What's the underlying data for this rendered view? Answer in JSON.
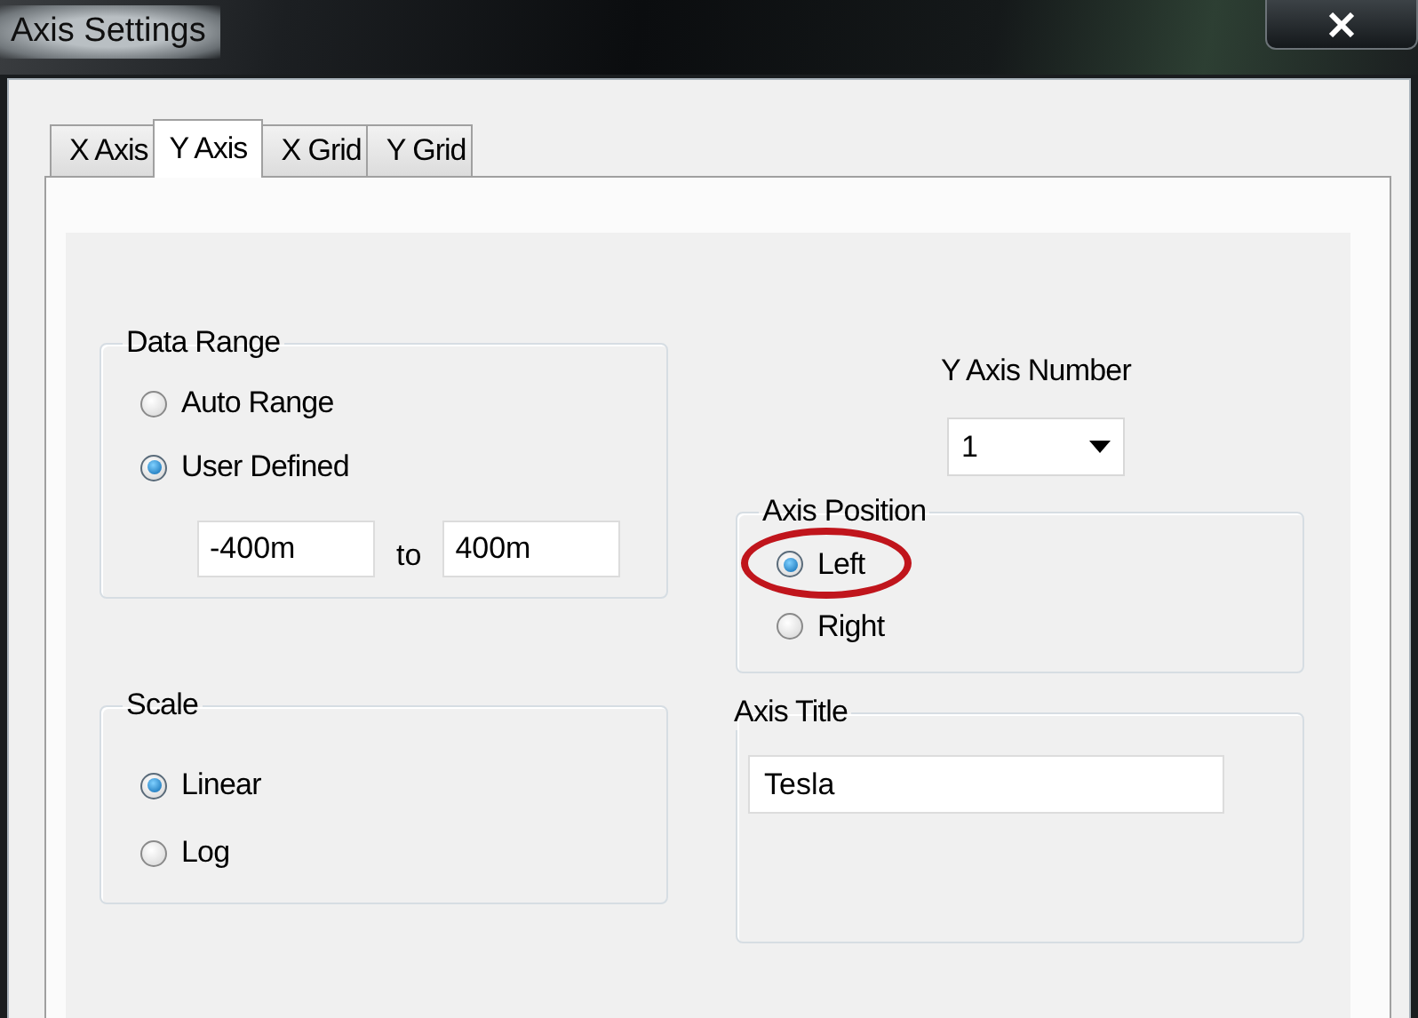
{
  "window": {
    "title": "Axis Settings"
  },
  "tabs": [
    {
      "label": "X Axis",
      "selected": false
    },
    {
      "label": "Y Axis",
      "selected": true
    },
    {
      "label": "X Grid",
      "selected": false
    },
    {
      "label": "Y Grid",
      "selected": false
    }
  ],
  "data_range": {
    "title": "Data Range",
    "options": [
      {
        "label": "Auto Range",
        "selected": false
      },
      {
        "label": "User Defined",
        "selected": true
      }
    ],
    "from": "-400m",
    "to_label": "to",
    "to": "400m"
  },
  "scale": {
    "title": "Scale",
    "options": [
      {
        "label": "Linear",
        "selected": true
      },
      {
        "label": "Log",
        "selected": false
      }
    ]
  },
  "y_axis_number": {
    "label": "Y Axis Number",
    "value": "1"
  },
  "axis_position": {
    "title": "Axis Position",
    "options": [
      {
        "label": "Left",
        "selected": true,
        "circled": true
      },
      {
        "label": "Right",
        "selected": false,
        "circled": false
      }
    ]
  },
  "axis_title": {
    "title": "Axis Title",
    "value": "Tesla"
  }
}
